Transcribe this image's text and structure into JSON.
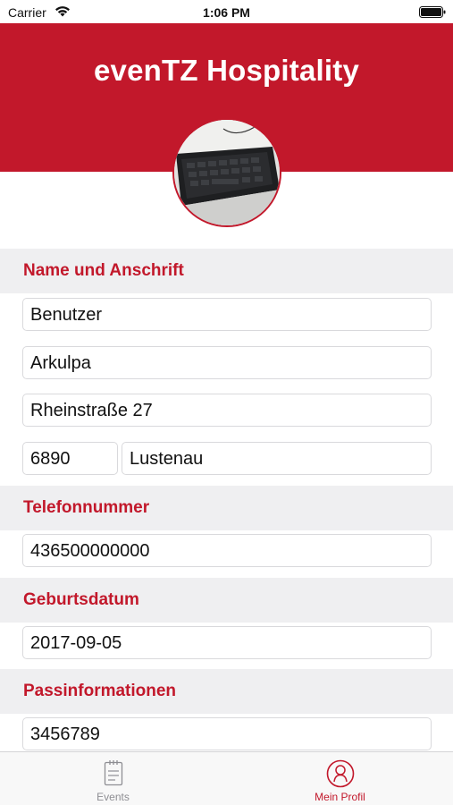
{
  "status_bar": {
    "carrier": "Carrier",
    "time": "1:06 PM"
  },
  "header": {
    "title": "evenTZ Hospitality"
  },
  "sections": {
    "address": {
      "title": "Name und Anschrift",
      "first_name": "Benutzer",
      "last_name": "Arkulpa",
      "street": "Rheinstraße 27",
      "zip": "6890",
      "city": "Lustenau"
    },
    "phone": {
      "title": "Telefonnummer",
      "value": "436500000000"
    },
    "birthdate": {
      "title": "Geburtsdatum",
      "value": "2017-09-05"
    },
    "passport": {
      "title": "Passinformationen",
      "value": "3456789"
    }
  },
  "tabs": [
    {
      "label": "Events",
      "icon": "document-icon",
      "active": false
    },
    {
      "label": "Mein Profil",
      "icon": "profile-icon",
      "active": true
    }
  ],
  "colors": {
    "accent": "#c2182b",
    "section_bg": "#efeff1",
    "tab_inactive": "#8e8e93"
  }
}
